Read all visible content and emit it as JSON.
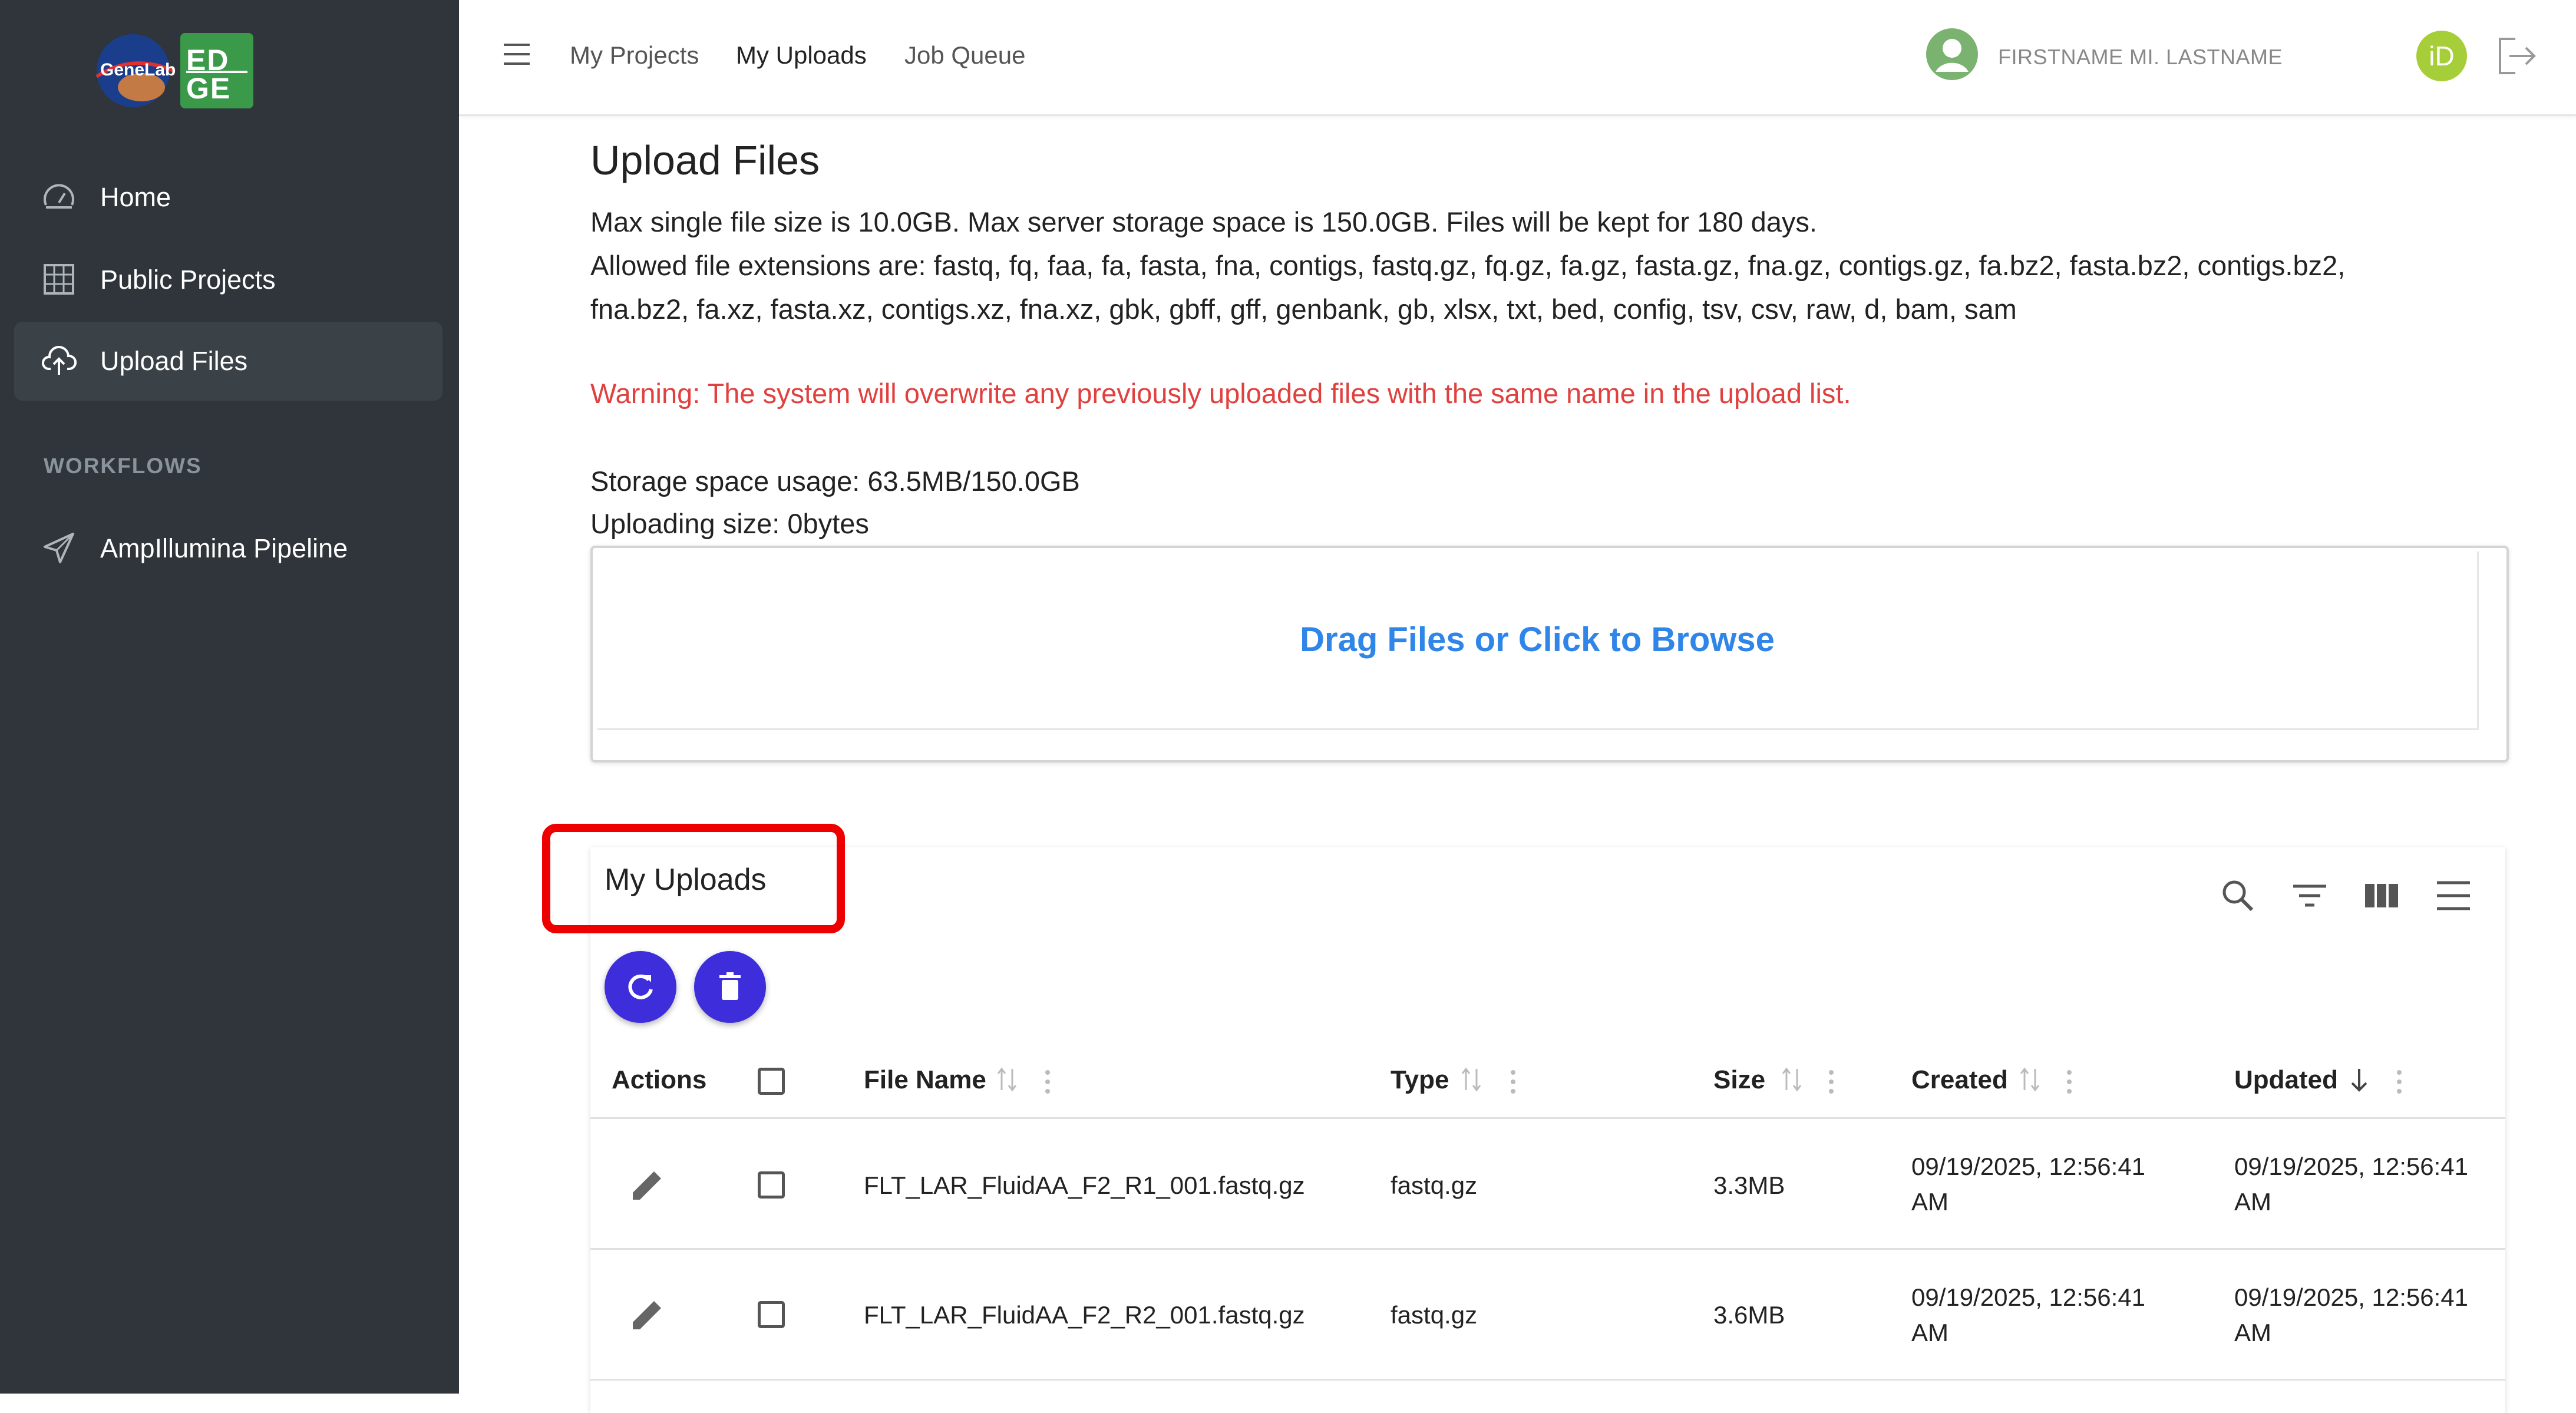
{
  "sidebar": {
    "logo_text_genelab": "GeneLab",
    "logo_text_edge": "EDGE",
    "items": [
      {
        "label": "Home",
        "icon": "speedometer-icon"
      },
      {
        "label": "Public Projects",
        "icon": "grid-icon"
      },
      {
        "label": "Upload Files",
        "icon": "cloud-upload-icon",
        "active": true
      }
    ],
    "section_label": "WORKFLOWS",
    "workflows": [
      {
        "label": "AmpIllumina Pipeline",
        "icon": "send-icon"
      }
    ]
  },
  "header": {
    "links": [
      "My Projects",
      "My Uploads",
      "Job Queue"
    ],
    "active_link": "My Uploads",
    "user_name": "FIRSTNAME MI. LASTNAME",
    "orcid_label": "iD"
  },
  "main": {
    "title": "Upload Files",
    "limits_text": "Max single file size is 10.0GB. Max server storage space is 150.0GB. Files will be kept for 180 days.",
    "extensions_line1": "Allowed file extensions are: fastq, fq, faa, fa, fasta, fna, contigs, fastq.gz, fq.gz, fa.gz, fasta.gz, fna.gz, contigs.gz, fa.bz2, fasta.bz2, contigs.bz2,",
    "extensions_line2": "fna.bz2, fa.xz, fasta.xz, contigs.xz, fna.xz, gbk, gbff, gff, genbank, gb, xlsx, txt, bed, config, tsv, csv, raw, d, bam, sam",
    "warning": "Warning: The system will overwrite any previously uploaded files with the same name in the upload list.",
    "storage_usage": "Storage space usage: 63.5MB/150.0GB",
    "uploading_size": "Uploading size: 0bytes",
    "dropzone_label": "Drag Files or Click to Browse"
  },
  "uploads_table": {
    "title": "My Uploads",
    "columns": [
      "Actions",
      "File Name",
      "Type",
      "Size",
      "Created",
      "Updated"
    ],
    "rows": [
      {
        "file_name": "FLT_LAR_FluidAA_F2_R1_001.fastq.gz",
        "type": "fastq.gz",
        "size": "3.3MB",
        "created": "09/19/2025, 12:56:41 AM",
        "updated": "09/19/2025, 12:56:41 AM"
      },
      {
        "file_name": "FLT_LAR_FluidAA_F2_R2_001.fastq.gz",
        "type": "fastq.gz",
        "size": "3.6MB",
        "created": "09/19/2025, 12:56:41 AM",
        "updated": "09/19/2025, 12:56:41 AM"
      }
    ]
  },
  "colors": {
    "sidebar_bg": "#2f353a",
    "accent_blue": "#2f86e8",
    "warning_red": "#e0413f",
    "action_button": "#3d2ddb",
    "highlight_red": "#ee0000"
  }
}
